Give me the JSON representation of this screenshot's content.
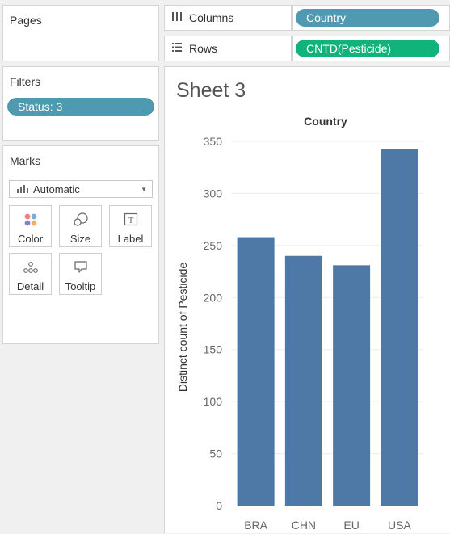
{
  "pages": {
    "title": "Pages"
  },
  "filters": {
    "title": "Filters",
    "items": [
      "Status: 3"
    ]
  },
  "marks": {
    "title": "Marks",
    "type": "Automatic",
    "buttons": [
      "Color",
      "Size",
      "Label",
      "Detail",
      "Tooltip"
    ]
  },
  "shelves": {
    "columns": {
      "label": "Columns",
      "pill": "Country"
    },
    "rows": {
      "label": "Rows",
      "pill": "CNTD(Pesticide)"
    }
  },
  "sheet": {
    "title": "Sheet 3"
  },
  "colors": {
    "bar": "#4e79a7",
    "dimension_pill": "#4f9ab1",
    "measure_pill": "#12b27b"
  },
  "chart_data": {
    "type": "bar",
    "header": "Country",
    "ylabel": "Distinct count of Pesticide",
    "categories": [
      "BRA",
      "CHN",
      "EU",
      "USA"
    ],
    "values": [
      258,
      240,
      231,
      343
    ],
    "ylim": [
      0,
      350
    ],
    "yticks": [
      0,
      50,
      100,
      150,
      200,
      250,
      300,
      350
    ],
    "grid": true
  }
}
